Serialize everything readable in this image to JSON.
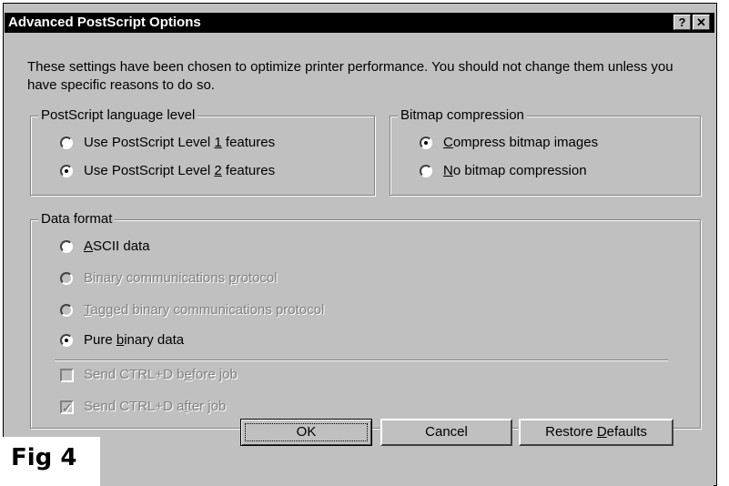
{
  "window": {
    "title": "Advanced PostScript Options",
    "help_btn": "?",
    "close_btn": "✕"
  },
  "description": "These settings have been chosen to optimize printer performance. You should not change them unless you have specific reasons to do so.",
  "language_level": {
    "legend": "PostScript language level",
    "options": [
      {
        "pre": "Use PostScript Level ",
        "key": "1",
        "post": " features",
        "selected": false
      },
      {
        "pre": "Use PostScript Level ",
        "key": "2",
        "post": " features",
        "selected": true
      }
    ]
  },
  "bitmap": {
    "legend": "Bitmap compression",
    "options": [
      {
        "pre": "",
        "key": "C",
        "post": "ompress bitmap images",
        "selected": true
      },
      {
        "pre": "",
        "key": "N",
        "post": "o bitmap compression",
        "selected": false
      }
    ]
  },
  "data_format": {
    "legend": "Data format",
    "options": [
      {
        "pre": "",
        "key": "A",
        "post": "SCII data",
        "selected": false,
        "disabled": false
      },
      {
        "pre": "Binary communications ",
        "key": "p",
        "post": "rotocol",
        "selected": false,
        "disabled": true
      },
      {
        "pre": "",
        "key": "T",
        "post": "agged binary communications protocol",
        "selected": false,
        "disabled": true
      },
      {
        "pre": "Pure ",
        "key": "b",
        "post": "inary data",
        "selected": true,
        "disabled": false
      }
    ],
    "checks": [
      {
        "pre": "Send CTRL+D b",
        "key": "e",
        "post": "fore job",
        "checked": false,
        "disabled": true
      },
      {
        "pre": "Send CTRL+D a",
        "key": "f",
        "post": "ter job",
        "checked": true,
        "disabled": true
      }
    ]
  },
  "buttons": {
    "ok": "OK",
    "cancel": "Cancel",
    "restore_pre": "Restore ",
    "restore_key": "D",
    "restore_post": "efaults"
  },
  "figure_label": "Fig 4"
}
